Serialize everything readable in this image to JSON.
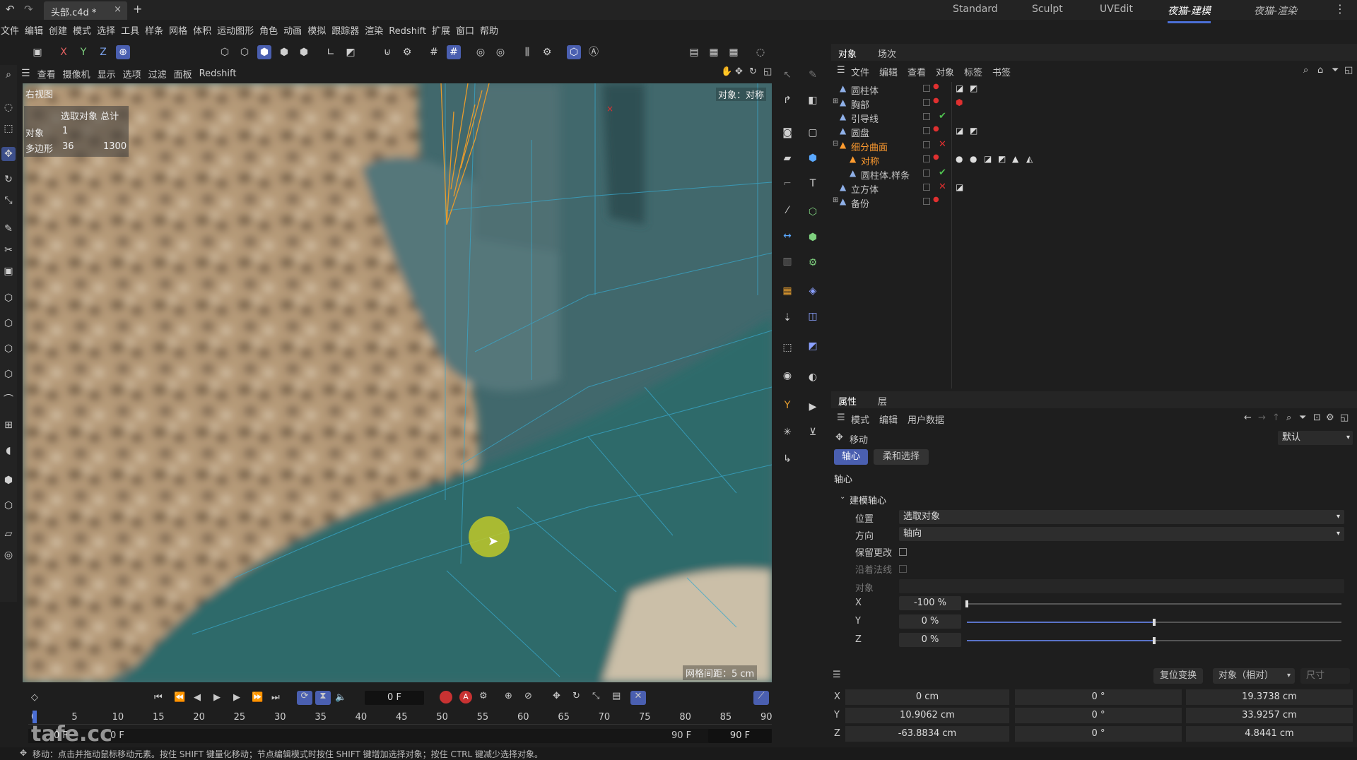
{
  "titlebar": {
    "doc_tab": "头部.c4d *",
    "close": "×",
    "new_tab": "+",
    "layouts": [
      "Standard",
      "Sculpt",
      "UVEdit",
      "夜猫-建模",
      "夜猫-渲染"
    ],
    "active_layout": "夜猫-建模"
  },
  "menubar": [
    "文件",
    "编辑",
    "创建",
    "模式",
    "选择",
    "工具",
    "样条",
    "网格",
    "体积",
    "运动图形",
    "角色",
    "动画",
    "模拟",
    "跟踪器",
    "渲染",
    "Redshift",
    "扩展",
    "窗口",
    "帮助"
  ],
  "toolbar": {
    "axes": [
      "X",
      "Y",
      "Z"
    ]
  },
  "viewport": {
    "menu": [
      "查看",
      "摄像机",
      "显示",
      "选项",
      "过滤",
      "面板",
      "Redshift"
    ],
    "view_name": "右视图",
    "hud": {
      "header": "选取对象 总计",
      "rows": [
        {
          "label": "对象",
          "sel": "1",
          "total": ""
        },
        {
          "label": "多边形",
          "sel": "36",
          "total": "1300"
        }
      ]
    },
    "object_label": "对象：对称",
    "grid_spacing": "网格间距：5 cm"
  },
  "object_manager": {
    "tabs": [
      "对象",
      "场次"
    ],
    "menu": [
      "文件",
      "编辑",
      "查看",
      "对象",
      "标签",
      "书签"
    ],
    "objects": [
      {
        "name": "圆柱体",
        "indent": 0,
        "expand": "",
        "selected": false,
        "status": "dot"
      },
      {
        "name": "胸部",
        "indent": 0,
        "expand": "+",
        "selected": false,
        "status": "dot"
      },
      {
        "name": "引导线",
        "indent": 0,
        "expand": "",
        "selected": false,
        "status": "check"
      },
      {
        "name": "圆盘",
        "indent": 0,
        "expand": "",
        "selected": false,
        "status": "dot"
      },
      {
        "name": "细分曲面",
        "indent": 0,
        "expand": "-",
        "selected": true,
        "status": "x"
      },
      {
        "name": "对称",
        "indent": 1,
        "expand": "",
        "selected": true,
        "status": "dot"
      },
      {
        "name": "圆柱体.样条",
        "indent": 1,
        "expand": "",
        "selected": false,
        "status": "check"
      },
      {
        "name": "立方体",
        "indent": 0,
        "expand": "",
        "selected": false,
        "status": "x"
      },
      {
        "name": "备份",
        "indent": 0,
        "expand": "+",
        "selected": false,
        "status": "dot"
      }
    ]
  },
  "attributes": {
    "tabs": [
      "属性",
      "层"
    ],
    "menu": [
      "模式",
      "编辑",
      "用户数据"
    ],
    "tool_name": "移动",
    "preset": "默认",
    "subtabs": [
      "轴心",
      "柔和选择"
    ],
    "section": "轴心",
    "group": "建模轴心",
    "fields": {
      "position_label": "位置",
      "position_value": "选取对象",
      "orientation_label": "方向",
      "orientation_value": "轴向",
      "keep_changes": "保留更改",
      "along_normal": "沿着法线",
      "object": "对象"
    },
    "axes": [
      {
        "label": "X",
        "value": "-100 %",
        "fraction": 0.0
      },
      {
        "label": "Y",
        "value": "0 %",
        "fraction": 0.5
      },
      {
        "label": "Z",
        "value": "0 %",
        "fraction": 0.5
      }
    ]
  },
  "coordinates": {
    "reset_button": "复位变换",
    "mode": "对象（相对）",
    "size_label": "尺寸",
    "rows": [
      {
        "axis": "X",
        "pos": "0 cm",
        "rot": "0 °",
        "size": "19.3738 cm"
      },
      {
        "axis": "Y",
        "pos": "10.9062 cm",
        "rot": "0 °",
        "size": "33.9257 cm"
      },
      {
        "axis": "Z",
        "pos": "-63.8834 cm",
        "rot": "0 °",
        "size": "4.8441 cm"
      }
    ]
  },
  "timeline": {
    "current_frame": "0 F",
    "ruler": [
      "0",
      "5",
      "10",
      "15",
      "20",
      "25",
      "30",
      "35",
      "40",
      "45",
      "50",
      "55",
      "60",
      "65",
      "70",
      "75",
      "80",
      "85",
      "90"
    ],
    "start": "0 F",
    "start2": "0 F",
    "end": "90 F",
    "end2": "90 F"
  },
  "status": "移动：点击并拖动鼠标移动元素。按住 SHIFT 键量化移动；节点编辑模式时按住 SHIFT 键增加选择对象；按住 CTRL 键减少选择对象。",
  "watermark": "tafe.cc"
}
